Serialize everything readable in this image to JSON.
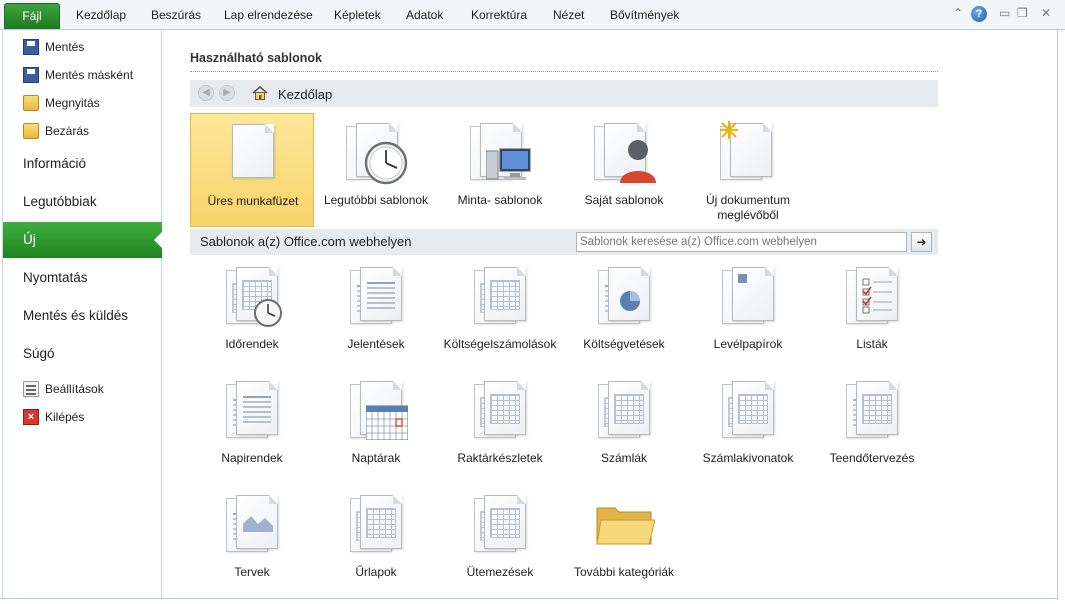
{
  "ribbon": {
    "file_tab": "Fájl",
    "tabs": [
      "Kezdőlap",
      "Beszúrás",
      "Lap elrendezése",
      "Képletek",
      "Adatok",
      "Korrektúra",
      "Nézet",
      "Bővítmények"
    ],
    "help": "?"
  },
  "nav": {
    "save": "Mentés",
    "save_as": "Mentés másként",
    "open": "Megnyitás",
    "close": "Bezárás",
    "info": "Információ",
    "recent": "Legutóbbiak",
    "new": "Új",
    "print": "Nyomtatás",
    "save_send": "Mentés és küldés",
    "help": "Súgó",
    "options": "Beállítások",
    "exit": "Kilépés"
  },
  "main": {
    "section_title": "Használható sablonok",
    "breadcrumb": "Kezdőlap",
    "templates": [
      {
        "label": "Üres munkafüzet",
        "selected": true
      },
      {
        "label": "Legutóbbi sablonok",
        "selected": false
      },
      {
        "label": "Minta- sablonok",
        "selected": false
      },
      {
        "label": "Saját sablonok",
        "selected": false
      },
      {
        "label": "Új dokumentum meglévőből",
        "selected": false
      }
    ],
    "office_label": "Sablonok a(z) Office.com webhelyen",
    "search_placeholder": "Sablonok keresése a(z) Office.com webhelyen",
    "office_categories": [
      "Időrendek",
      "Jelentések",
      "Költségelszámolások",
      "Költségvetések",
      "Levélpapírok",
      "Listák",
      "Napirendek",
      "Naptárak",
      "Raktárkészletek",
      "Számlák",
      "Számlakivonatok",
      "Teendőtervezés",
      "Tervek",
      "Űrlapok",
      "Ütemezések",
      "További kategóriák"
    ]
  }
}
